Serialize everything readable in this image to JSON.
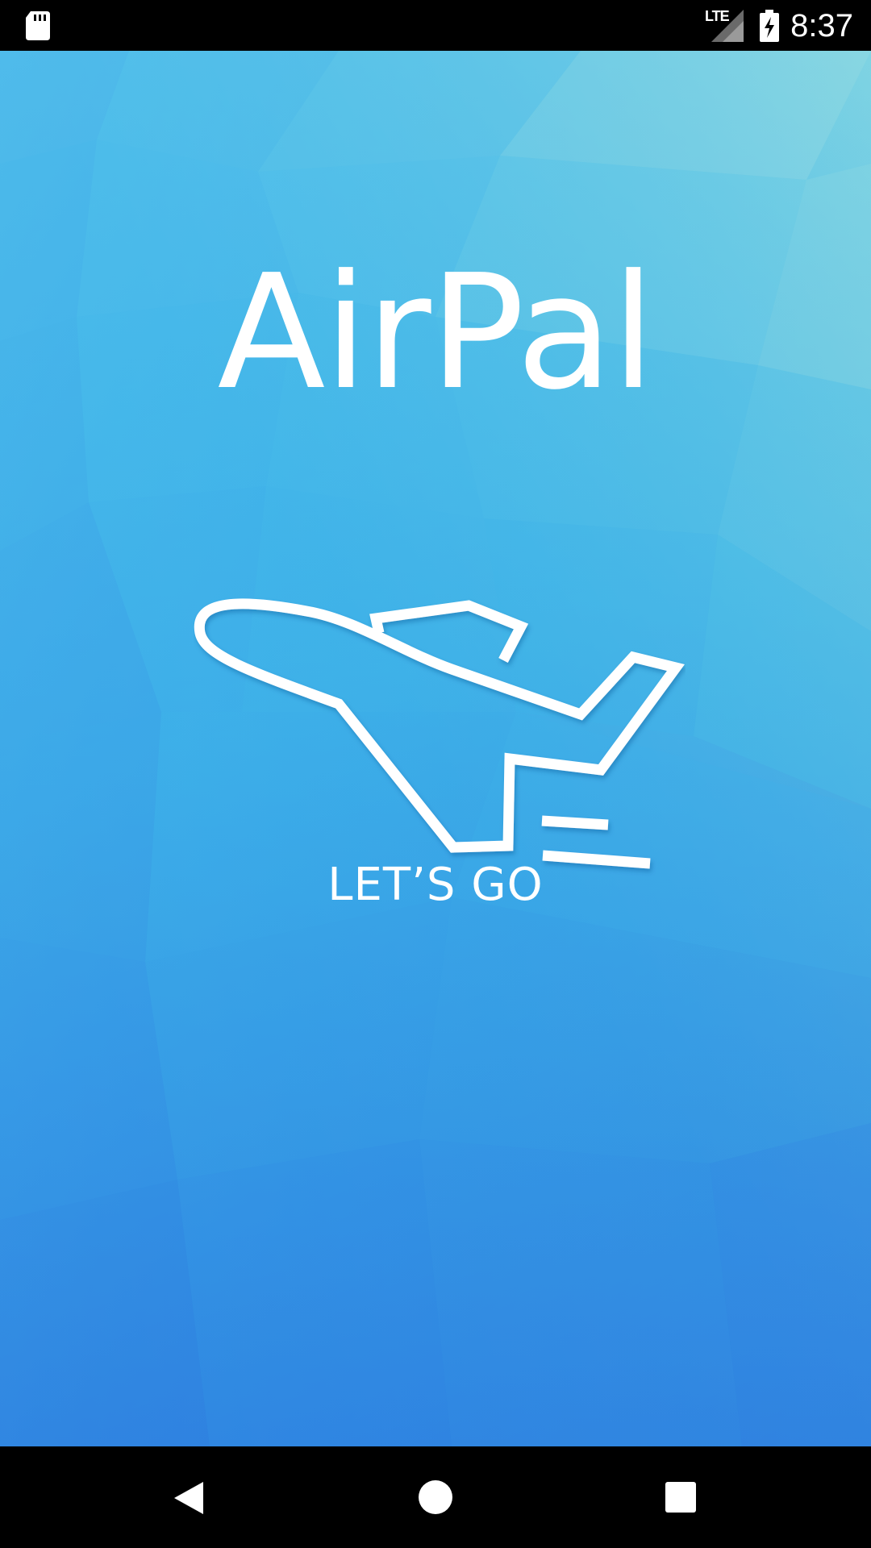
{
  "status_bar": {
    "network_label": "LTE",
    "time": "8:37"
  },
  "splash": {
    "title": "AirPal",
    "tagline": "LET’S GO",
    "logo_icon": "airplane-takeoff-icon"
  },
  "nav_bar": {
    "back_icon": "back-triangle-icon",
    "home_icon": "home-circle-icon",
    "recents_icon": "recents-square-icon"
  },
  "colors": {
    "status_bar_bg": "#000000",
    "nav_bar_bg": "#000000",
    "gradient_top": "#4fd3e6",
    "gradient_bottom": "#2d7fe2",
    "foreground": "#ffffff"
  }
}
